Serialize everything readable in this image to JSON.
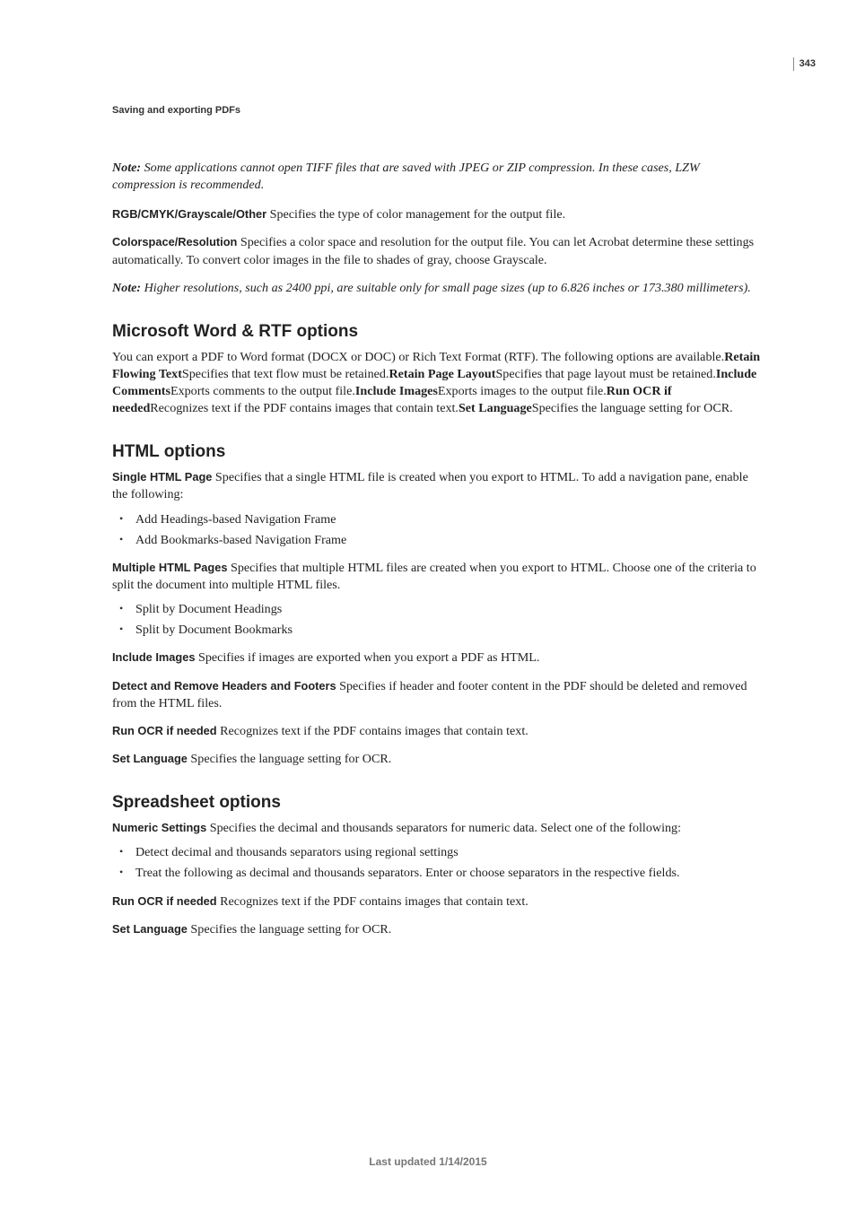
{
  "pageNumber": "343",
  "runningHeader": "Saving and exporting PDFs",
  "note1": {
    "label": "Note:",
    "text": " Some applications cannot open TIFF files that are saved with JPEG or ZIP compression. In these cases, LZW compression is recommended."
  },
  "rgb": {
    "term": "RGB/CMYK/Grayscale/Other",
    "text": "  Specifies the type of color management for the output file."
  },
  "colorspace": {
    "term": "Colorspace/Resolution",
    "text": "  Specifies a color space and resolution for the output file. You can let Acrobat determine these settings automatically. To convert color images in the file to shades of gray, choose Grayscale."
  },
  "note2": {
    "label": "Note:",
    "text": " Higher resolutions, such as 2400 ppi, are suitable only for small page sizes (up to 6.826 inches or 173.380 millimeters)."
  },
  "wordHeading": "Microsoft Word & RTF options",
  "wordPara": {
    "p1": "You can export a PDF to Word format (DOCX or DOC) or Rich Text Format (RTF). The following options are available.",
    "b1": "Retain Flowing Text",
    "t1": "Specifies that text flow must be retained.",
    "b2": "Retain Page Layout",
    "t2": "Specifies that page layout must be retained.",
    "b3": "Include Comments",
    "t3": "Exports comments to the output file.",
    "b4": "Include Images",
    "t4": "Exports images to the output file.",
    "b5": "Run OCR if needed",
    "t5": "Recognizes text if the PDF contains images that contain text.",
    "b6": "Set Language",
    "t6": "Specifies the language setting for OCR."
  },
  "htmlHeading": "HTML options",
  "singleHtml": {
    "term": "Single HTML Page",
    "text": "  Specifies that a single HTML file is created when you export to HTML. To add a navigation pane, enable the following:"
  },
  "singleHtmlList": [
    "Add Headings-based Navigation Frame",
    "Add Bookmarks-based Navigation Frame"
  ],
  "multiHtml": {
    "term": "Multiple HTML Pages",
    "text": "  Specifies that multiple HTML files are created when you export to HTML. Choose one of the criteria to split the document into multiple HTML files."
  },
  "multiHtmlList": [
    "Split by Document Headings",
    "Split by Document Bookmarks"
  ],
  "includeImages": {
    "term": "Include Images",
    "text": "  Specifies if images are exported when you export a PDF as HTML."
  },
  "detectHeaders": {
    "term": "Detect and Remove Headers and Footers",
    "text": "  Specifies if header and footer content in the PDF should be deleted and removed from the HTML files."
  },
  "runOcrHtml": {
    "term": "Run OCR if needed",
    "text": "  Recognizes text if the PDF contains images that contain text."
  },
  "setLangHtml": {
    "term": "Set Language",
    "text": "  Specifies the language setting for OCR."
  },
  "spreadHeading": "Spreadsheet options",
  "numeric": {
    "term": "Numeric Settings",
    "text": "  Specifies the decimal and thousands separators for numeric data. Select one of the following:"
  },
  "numericList": [
    "Detect decimal and thousands separators using regional settings",
    "Treat the following as decimal and thousands separators. Enter or choose separators in the respective fields."
  ],
  "runOcrSpread": {
    "term": "Run OCR if needed",
    "text": "  Recognizes text if the PDF contains images that contain text."
  },
  "setLangSpread": {
    "term": "Set Language",
    "text": "  Specifies the language setting for OCR."
  },
  "footer": "Last updated 1/14/2015"
}
